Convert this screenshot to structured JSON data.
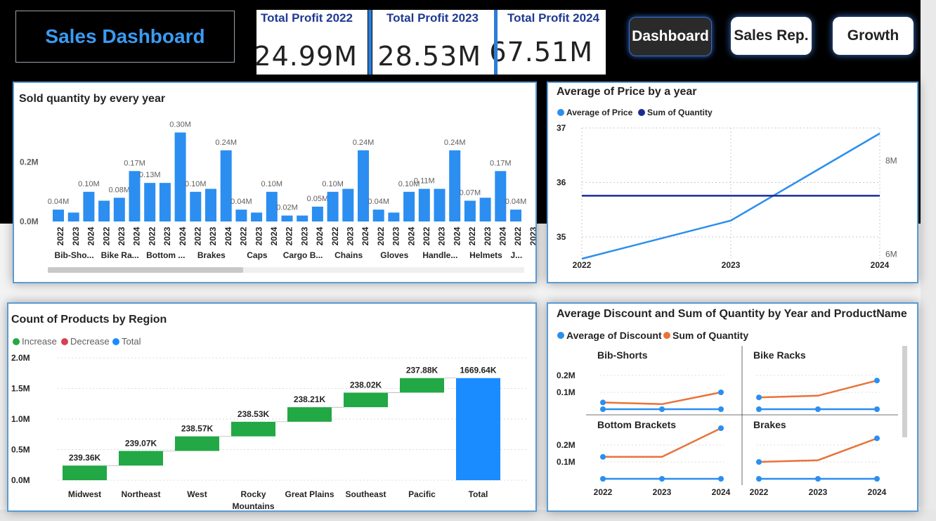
{
  "header": {
    "title": "Sales Dashboard",
    "kpis": [
      {
        "label": "Total Profit 2022",
        "value": "24.99M"
      },
      {
        "label": "Total Profit 2023",
        "value": "28.53M"
      },
      {
        "label": "Total Profit 2024",
        "value": "67.51M"
      }
    ],
    "nav": [
      {
        "label": "Dashboard",
        "active": true
      },
      {
        "label": "Sales Rep.",
        "active": false
      },
      {
        "label": "Growth",
        "active": false
      }
    ]
  },
  "colors": {
    "accent": "#2b8ef0",
    "navy": "#1a2b96",
    "orange": "#e8733a",
    "green": "#22a845",
    "red": "#d9404f",
    "total": "#1a8cff"
  },
  "chart_data": [
    {
      "type": "bar",
      "title": "Sold quantity by every year",
      "yticks": [
        "0.0M",
        "0.2M"
      ],
      "ylim": [
        0,
        0.32
      ],
      "categories": [
        "2022",
        "2023",
        "2024",
        "2022",
        "2023",
        "2024",
        "2022",
        "2023",
        "2024",
        "2022",
        "2023",
        "2024",
        "2022",
        "2023",
        "2024",
        "2022",
        "2023",
        "2024",
        "2022",
        "2023",
        "2024",
        "2022",
        "2023",
        "2024",
        "2022",
        "2023",
        "2024",
        "2022",
        "2023",
        "2024",
        "2022",
        "2023",
        "2024",
        "2022"
      ],
      "groups": [
        "Bib-Sho...",
        "Bike Ra...",
        "Bottom ...",
        "Brakes",
        "Caps",
        "Cargo B...",
        "Chains",
        "Gloves",
        "Handle...",
        "Helmets",
        "J..."
      ],
      "values": [
        0.04,
        0.03,
        0.1,
        0.07,
        0.08,
        0.17,
        0.13,
        0.13,
        0.3,
        0.1,
        0.11,
        0.24,
        0.04,
        0.03,
        0.1,
        0.02,
        0.02,
        0.05,
        0.1,
        0.11,
        0.24,
        0.04,
        0.03,
        0.1,
        0.11,
        0.11,
        0.24,
        0.07,
        0.08,
        0.17,
        0.04
      ],
      "labels": [
        "0.04M",
        "",
        "0.10M",
        "",
        "0.08M",
        "0.17M",
        "0.13M",
        "",
        "0.30M",
        "0.10M",
        "",
        "0.24M",
        "0.04M",
        "",
        "0.10M",
        "0.02M",
        "",
        "0.05M",
        "0.10M",
        "",
        "0.24M",
        "0.04M",
        "",
        "0.10M",
        "0.11M",
        "",
        "0.24M",
        "0.07M",
        "",
        "0.17M",
        "0.04M"
      ],
      "grid": false
    },
    {
      "type": "line",
      "title": "Average of Price by a year",
      "x": [
        "2022",
        "2023",
        "2024"
      ],
      "legend": [
        "Average of Price",
        "Sum of Quantity"
      ],
      "series": [
        {
          "name": "Average of Price",
          "values": [
            34.6,
            35.3,
            36.9
          ]
        },
        {
          "name": "Sum of Quantity",
          "values": [
            7.25,
            7.25,
            7.25
          ]
        }
      ],
      "ylim": [
        34.6,
        37
      ],
      "y2lim": [
        5.9,
        8.7
      ],
      "yticks": [
        "35",
        "36",
        "37"
      ],
      "y2ticks": [
        "6M",
        "8M"
      ],
      "grid": true
    },
    {
      "type": "waterfall",
      "title": "Count of Products by Region",
      "legend": [
        "Increase",
        "Decrease",
        "Total"
      ],
      "categories": [
        "Midwest",
        "Northeast",
        "West",
        "Rocky Mountains",
        "Great Plains",
        "Southeast",
        "Pacific",
        "Total"
      ],
      "values": [
        239.36,
        239.07,
        238.57,
        238.53,
        238.21,
        238.02,
        237.88,
        1669.64
      ],
      "labels": [
        "239.36K",
        "239.07K",
        "238.57K",
        "238.53K",
        "238.21K",
        "238.02K",
        "237.88K",
        "1669.64K"
      ],
      "yticks": [
        "0.0M",
        "0.5M",
        "1.0M",
        "1.5M",
        "2.0M"
      ],
      "ylim": [
        0,
        2000
      ]
    },
    {
      "type": "line",
      "title": "Average Discount and Sum of Quantity by Year and ProductName",
      "legend": [
        "Average of Discount",
        "Sum of Quantity"
      ],
      "x": [
        "2022",
        "2023",
        "2024"
      ],
      "yticks": [
        "0.1M",
        "0.2M"
      ],
      "ylim": [
        0,
        0.25
      ],
      "panels": [
        {
          "name": "Bib-Shorts",
          "quantity": [
            0.04,
            0.03,
            0.1
          ],
          "discount": [
            0.0,
            0.0,
            0.0
          ]
        },
        {
          "name": "Bike Racks",
          "quantity": [
            0.07,
            0.08,
            0.17
          ],
          "discount": [
            0.0,
            0.0,
            0.0
          ]
        },
        {
          "name": "Bottom Brackets",
          "quantity": [
            0.13,
            0.13,
            0.3
          ],
          "discount": [
            0.0,
            0.0,
            0.0
          ]
        },
        {
          "name": "Brakes",
          "quantity": [
            0.1,
            0.11,
            0.24
          ],
          "discount": [
            0.0,
            0.0,
            0.0
          ]
        }
      ]
    }
  ]
}
